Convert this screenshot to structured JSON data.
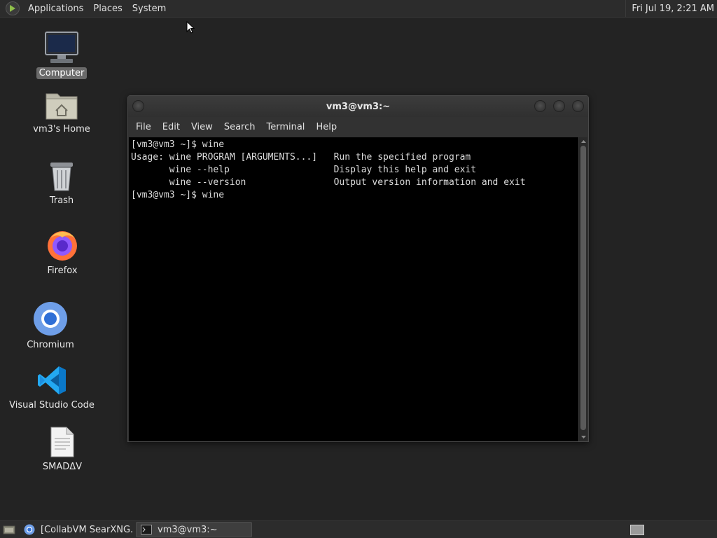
{
  "top_panel": {
    "menus": [
      "Applications",
      "Places",
      "System"
    ],
    "clock": "Fri Jul 19,  2:21 AM"
  },
  "desktop": {
    "icons": [
      {
        "label": "Computer",
        "icon": "computer-icon",
        "selected": true
      },
      {
        "label": "vm3's Home",
        "icon": "home-folder-icon"
      },
      {
        "label": "Trash",
        "icon": "trash-icon"
      },
      {
        "label": "Firefox",
        "icon": "firefox-icon"
      },
      {
        "label": "Chromium",
        "icon": "chromium-icon"
      },
      {
        "label": "Visual Studio Code",
        "icon": "vscode-icon"
      },
      {
        "label": "SMADΔV",
        "icon": "document-icon"
      }
    ]
  },
  "terminal": {
    "title": "vm3@vm3:~",
    "menus": [
      "File",
      "Edit",
      "View",
      "Search",
      "Terminal",
      "Help"
    ],
    "lines": [
      "[vm3@vm3 ~]$ wine",
      "Usage: wine PROGRAM [ARGUMENTS...]   Run the specified program",
      "       wine --help                   Display this help and exit",
      "       wine --version                Output version information and exit",
      "[vm3@vm3 ~]$ wine"
    ]
  },
  "taskbar": {
    "tasks": [
      {
        "label": "[CollabVM SearXNG...",
        "icon": "chromium-icon",
        "active": false
      },
      {
        "label": "vm3@vm3:~",
        "icon": "terminal-icon",
        "active": true
      }
    ]
  },
  "colors": {
    "desktop_bg": "#232323",
    "panel_bg": "#2c2c2c",
    "terminal_bg": "#000000",
    "terminal_fg": "#dcdcdc"
  }
}
